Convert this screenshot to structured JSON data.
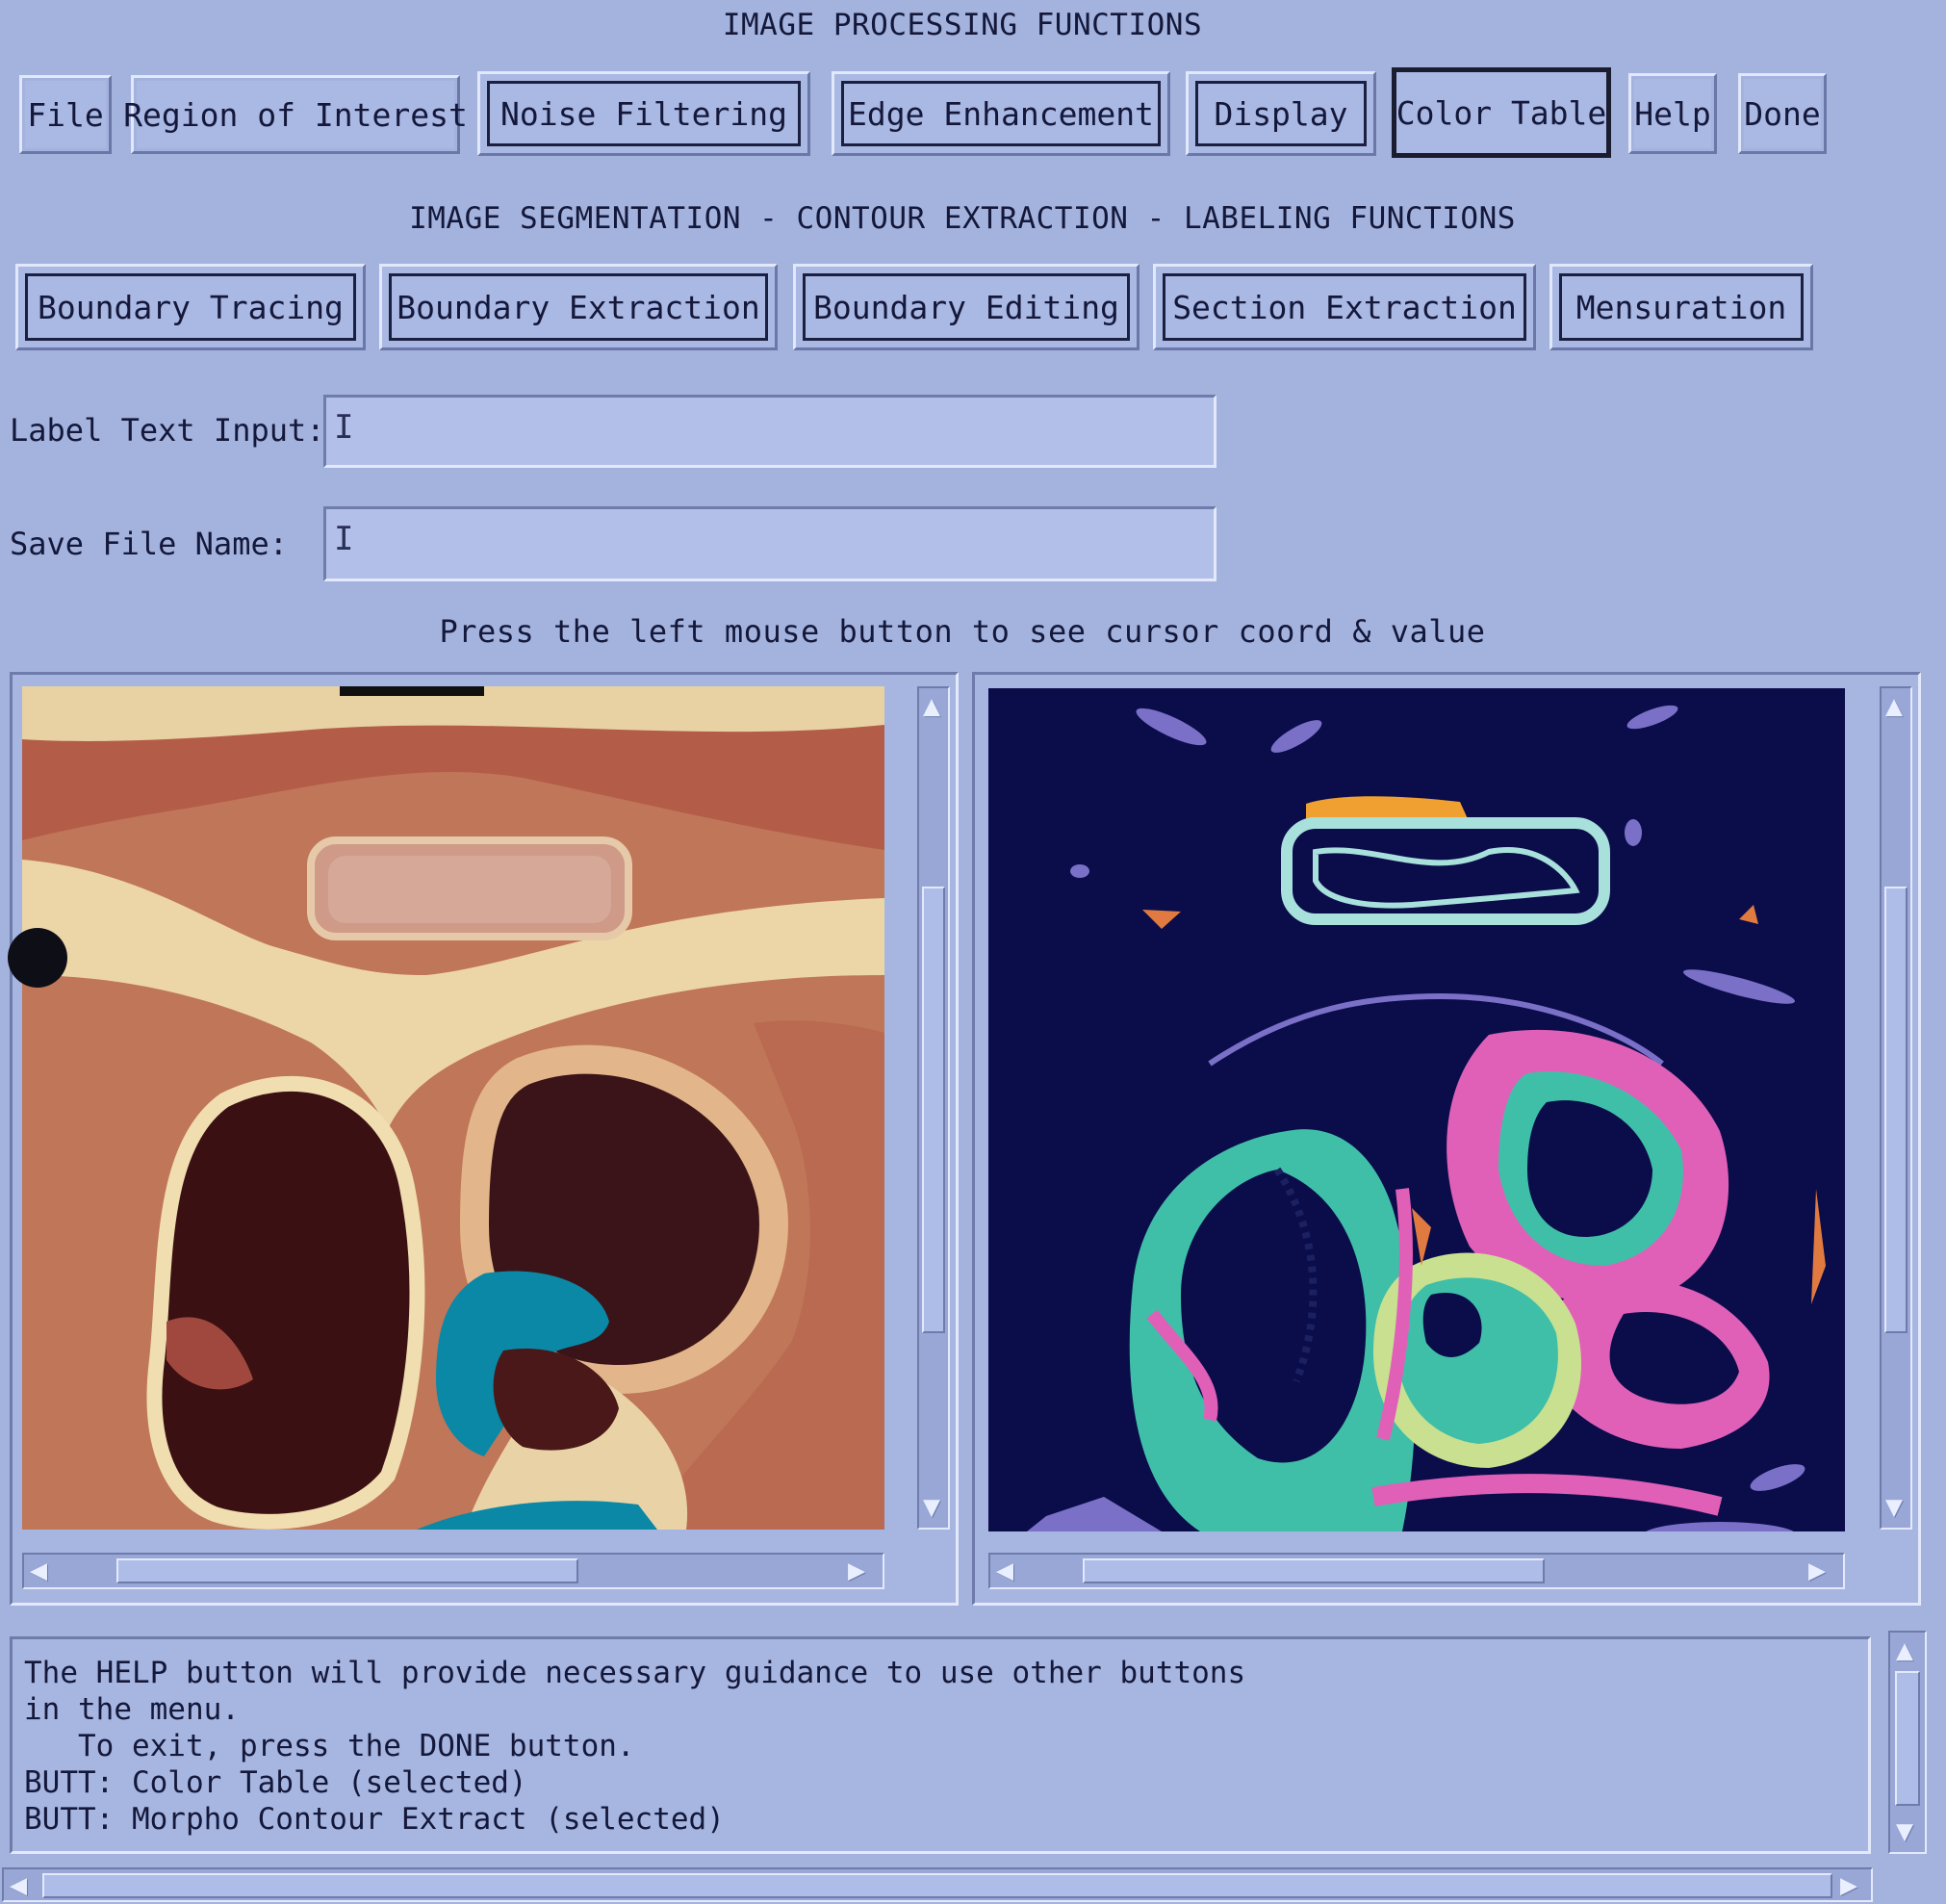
{
  "processing": {
    "title": "IMAGE PROCESSING FUNCTIONS",
    "buttons": [
      "File",
      "Region of Interest",
      "Noise Filtering",
      "Edge Enhancement",
      "Display",
      "Color Table",
      "Help",
      "Done"
    ]
  },
  "segmentation": {
    "title": "IMAGE SEGMENTATION - CONTOUR EXTRACTION - LABELING FUNCTIONS",
    "buttons": [
      "Boundary Tracing",
      "Boundary Extraction",
      "Boundary Editing",
      "Section Extraction",
      "Mensuration"
    ]
  },
  "form": {
    "label_text_label": "Label Text Input:",
    "label_text_value": "",
    "save_file_label": "Save File Name:",
    "save_file_value": ""
  },
  "instruction": "Press the left mouse button to see cursor coord & value",
  "message_log": [
    "The HELP button will provide necessary guidance to use other buttons",
    "in the menu.",
    "   To exit, press the DONE button.",
    "BUTT: Color Table (selected)",
    "BUTT: Morpho Contour Extract (selected)"
  ],
  "colors": {
    "background": "#a4b3de",
    "segmentation_background": "#0b0c4a",
    "contour_teal": "#3fbfa8",
    "contour_pink": "#e060b8",
    "contour_orange": "#f0a030",
    "contour_lavender": "#7a70c8",
    "roi_overlay": "#0a8aa8"
  },
  "icons": {
    "cursor": "i-beam-icon",
    "scroll_up": "arrow-up-icon",
    "scroll_down": "arrow-down-icon",
    "scroll_left": "arrow-left-icon",
    "scroll_right": "arrow-right-icon"
  }
}
